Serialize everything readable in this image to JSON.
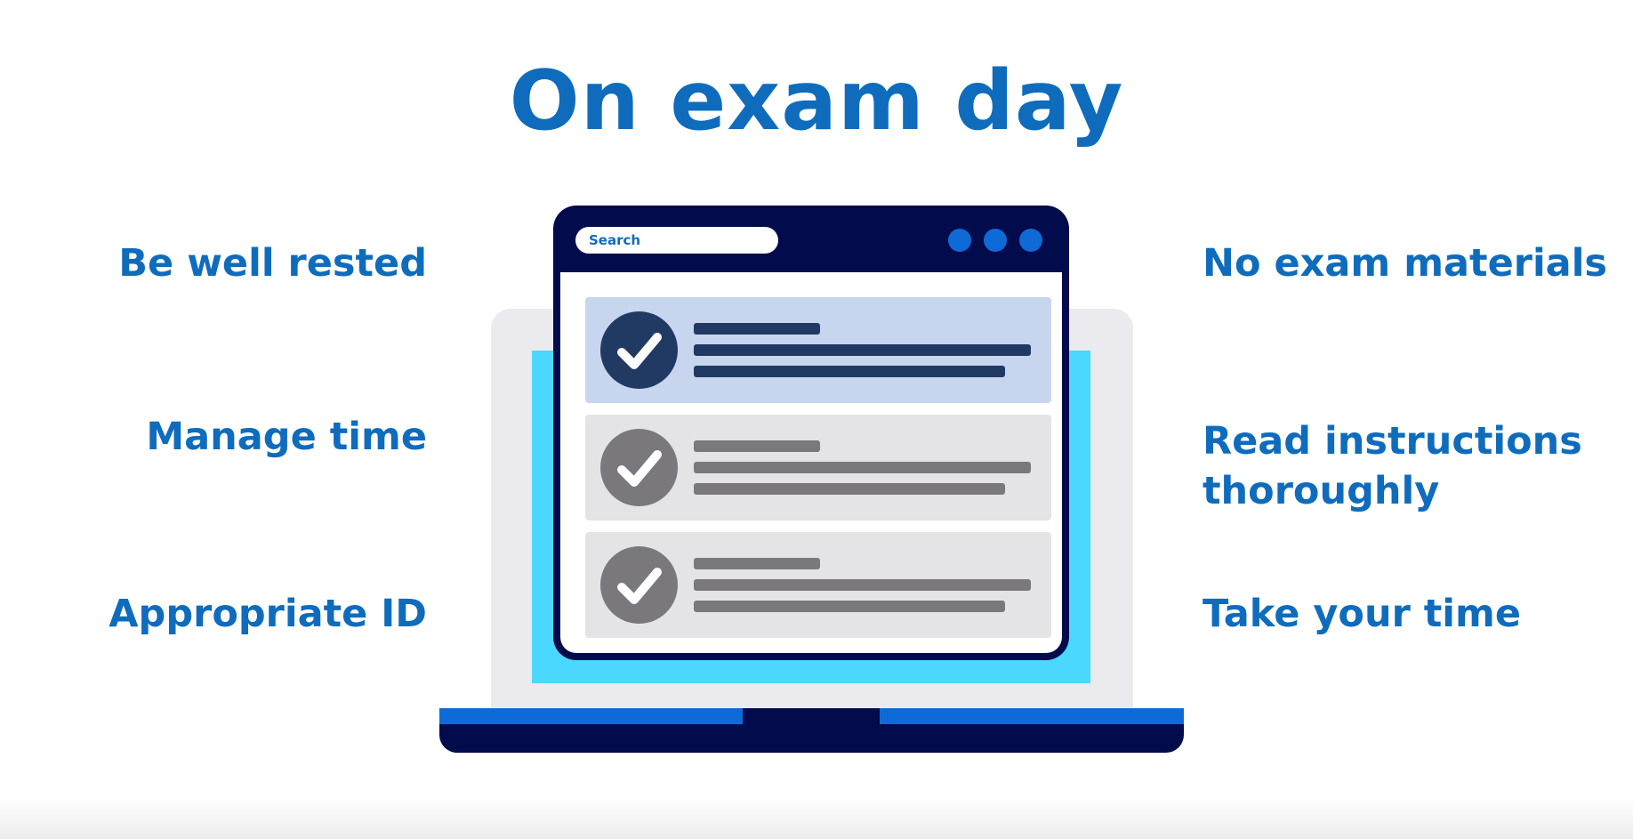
{
  "title": "On exam day",
  "tips_left": [
    "Be well rested",
    "Manage time",
    "Appropriate ID"
  ],
  "tips_right": [
    "No exam materials",
    "Read instructions\nthoroughly",
    "Take your time"
  ],
  "illustration": {
    "search_label": "Search",
    "cards": [
      {
        "state": "active",
        "icon": "checkmark-icon"
      },
      {
        "state": "inactive",
        "icon": "checkmark-icon"
      },
      {
        "state": "inactive",
        "icon": "checkmark-icon"
      }
    ],
    "colors": {
      "brand_blue": "#0f6cbd",
      "navy": "#020b4c",
      "screen_cyan": "#4bd8ff",
      "active_card": "#c7d5ee",
      "inactive_card": "#e4e4e6"
    }
  }
}
